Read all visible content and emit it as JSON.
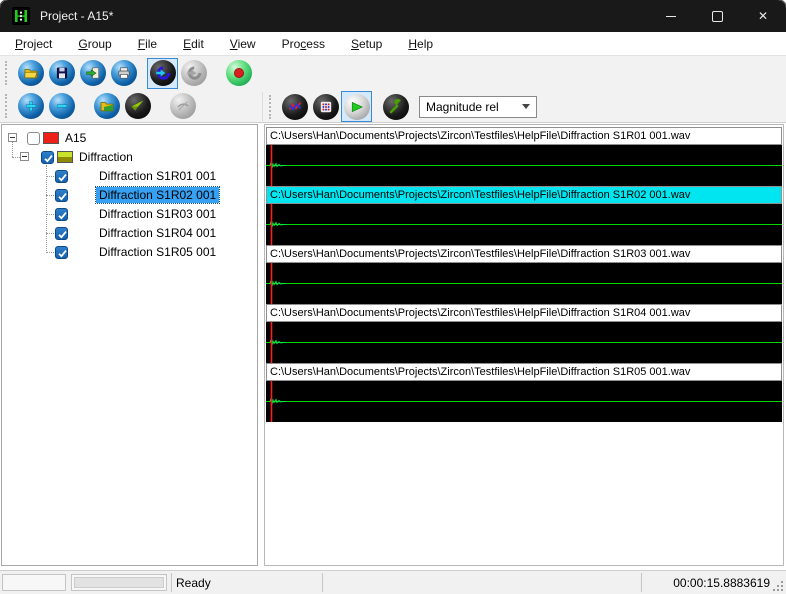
{
  "window": {
    "title": "Project - A15*",
    "controls": [
      {
        "name": "minimize-button",
        "icon": "minimize-icon"
      },
      {
        "name": "maximize-button",
        "icon": "maximize-icon"
      },
      {
        "name": "close-button",
        "icon": "close-icon"
      }
    ]
  },
  "menu": {
    "items": [
      {
        "label": "Project",
        "underline": 0
      },
      {
        "label": "Group",
        "underline": 0
      },
      {
        "label": "File",
        "underline": 0
      },
      {
        "label": "Edit",
        "underline": 0
      },
      {
        "label": "View",
        "underline": 0
      },
      {
        "label": "Process",
        "underline": 3
      },
      {
        "label": "Setup",
        "underline": 0
      },
      {
        "label": "Help",
        "underline": 0
      }
    ]
  },
  "toolbar_main": {
    "buttons": [
      {
        "name": "open-project-button",
        "icon": "folder-open-icon",
        "style": "blue"
      },
      {
        "name": "save-button",
        "icon": "save-icon",
        "style": "blue"
      },
      {
        "name": "export-button",
        "icon": "export-document-icon",
        "style": "blue"
      },
      {
        "name": "print-button",
        "icon": "printer-icon",
        "style": "blue"
      },
      {
        "name": "process-forward-button",
        "icon": "process-arrow-icon",
        "style": "black",
        "selected": true
      },
      {
        "name": "process-back-button",
        "icon": "process-arrow-disabled-icon",
        "style": "gray",
        "disabled": true
      },
      {
        "name": "record-button",
        "icon": "record-dot-icon",
        "style": "green"
      }
    ]
  },
  "toolbar_tree": {
    "buttons": [
      {
        "name": "add-button",
        "icon": "plus-icon",
        "style": "blue"
      },
      {
        "name": "remove-button",
        "icon": "minus-icon",
        "style": "blue"
      },
      {
        "name": "open-group-button",
        "icon": "folder-group-icon",
        "style": "blue"
      },
      {
        "name": "signal-view-button",
        "icon": "signal-wedge-icon",
        "style": "black"
      },
      {
        "name": "unavailable-button",
        "icon": "disabled-sphere-icon",
        "style": "gray",
        "disabled": true
      }
    ]
  },
  "toolbar_view": {
    "buttons": [
      {
        "name": "graph-view-button",
        "icon": "graph-curves-icon",
        "style": "black"
      },
      {
        "name": "matrix-view-button",
        "icon": "matrix-grid-icon",
        "style": "black"
      },
      {
        "name": "envelope-view-button",
        "icon": "play-wedge-icon",
        "style": "silver",
        "selected": true
      },
      {
        "name": "settings-button",
        "icon": "wrench-icon",
        "style": "black"
      }
    ],
    "combo": {
      "value": "Magnitude rel"
    }
  },
  "tree": {
    "root": {
      "label": "A15",
      "checked": false,
      "swatch_color": "#ee2118"
    },
    "group": {
      "label": "Diffraction",
      "checked": true,
      "swatch_top": "#c9e32c",
      "swatch_bottom": "#8f8b00"
    },
    "items": [
      {
        "label": "Diffraction S1R01 001",
        "checked": true,
        "selected": false
      },
      {
        "label": "Diffraction S1R02 001",
        "checked": true,
        "selected": true
      },
      {
        "label": "Diffraction S1R03 001",
        "checked": true,
        "selected": false
      },
      {
        "label": "Diffraction S1R04 001",
        "checked": true,
        "selected": false
      },
      {
        "label": "Diffraction S1R05 001",
        "checked": true,
        "selected": false
      }
    ]
  },
  "waveforms": {
    "strips": [
      {
        "path": "C:\\Users\\Han\\Documents\\Projects\\Zircon\\Testfiles\\HelpFile\\Diffraction S1R01 001.wav",
        "selected": false
      },
      {
        "path": "C:\\Users\\Han\\Documents\\Projects\\Zircon\\Testfiles\\HelpFile\\Diffraction S1R02 001.wav",
        "selected": true
      },
      {
        "path": "C:\\Users\\Han\\Documents\\Projects\\Zircon\\Testfiles\\HelpFile\\Diffraction S1R03 001.wav",
        "selected": false
      },
      {
        "path": "C:\\Users\\Han\\Documents\\Projects\\Zircon\\Testfiles\\HelpFile\\Diffraction S1R04 001.wav",
        "selected": false
      },
      {
        "path": "C:\\Users\\Han\\Documents\\Projects\\Zircon\\Testfiles\\HelpFile\\Diffraction S1R05 001.wav",
        "selected": false
      }
    ],
    "signal_color": "#00d800",
    "cursor_color": "#ff1c1c",
    "selected_header_color": "#00e5ef"
  },
  "status": {
    "ready": "Ready",
    "time": "00:00:15.8883619"
  },
  "colors": {
    "titlebar": "#191919",
    "toolbar_bg": "#f2f2f2",
    "selection_blue": "#36a0f2",
    "checkbox_blue": "#1661ad",
    "accent_border": "#3a8ad8"
  }
}
